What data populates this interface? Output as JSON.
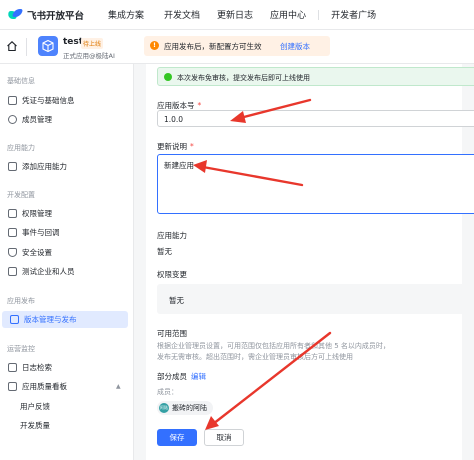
{
  "top_nav": {
    "brand": "飞书开放平台",
    "items": [
      "集成方案",
      "开发文档",
      "更新日志",
      "应用中心",
      "开发者广场"
    ]
  },
  "app_header": {
    "app_name": "test",
    "status_badge": "待上线",
    "subtitle": "正式应用@极陆AI",
    "notice_text": "应用发布后，新配置方可生效",
    "notice_link": "创建版本"
  },
  "sidebar": {
    "sections": [
      {
        "title": "基础信息",
        "items": [
          "凭证与基础信息",
          "成员管理"
        ]
      },
      {
        "title": "应用能力",
        "items": [
          "添加应用能力"
        ]
      },
      {
        "title": "开发配置",
        "items": [
          "权限管理",
          "事件与回调",
          "安全设置",
          "测试企业和人员"
        ]
      },
      {
        "title": "应用发布",
        "items": [
          "版本管理与发布"
        ]
      },
      {
        "title": "运营监控",
        "items": [
          "日志检索",
          "应用质量看板"
        ],
        "sub_items": [
          "用户反馈",
          "开发质量"
        ]
      }
    ],
    "active_item": "版本管理与发布"
  },
  "form": {
    "success_banner": "本次发布免审核，提交发布后即可上线使用",
    "version_label": "应用版本号",
    "version_value": "1.0.0",
    "required_mark": "*",
    "notes_label": "更新说明",
    "notes_value": "新建应用",
    "capability_label": "应用能力",
    "capability_value": "暂无",
    "permission_label": "权限变更",
    "permission_value": "暂无",
    "scope_label": "可用范围",
    "scope_hint": "根据企业管理员设置，可用范围仅包括应用所有者和其他 5 名以内成员时，发布无需审核。超出范围时，需企业管理员审核后方可上线使用",
    "members_label": "部分成员",
    "members_edit": "编辑",
    "members_sub": "成员：",
    "member_name": "搬砖的阿陆",
    "member_avatar_text": "阿陆",
    "save_button": "保存",
    "cancel_button": "取消"
  },
  "colors": {
    "accent": "#3370ff",
    "annotation_arrow": "#e8372c",
    "success_bg": "#eaf7ee",
    "warning_bg": "#fff1e5"
  },
  "icons": {
    "home": "home-icon",
    "app": "app-cube-icon",
    "notice": "warning-icon",
    "success": "check-circle-icon",
    "sidebar": [
      "credential-icon",
      "members-icon",
      "capability-icon",
      "permission-icon",
      "event-icon",
      "security-icon",
      "test-users-icon",
      "version-icon",
      "log-search-icon",
      "quality-dashboard-icon"
    ]
  }
}
